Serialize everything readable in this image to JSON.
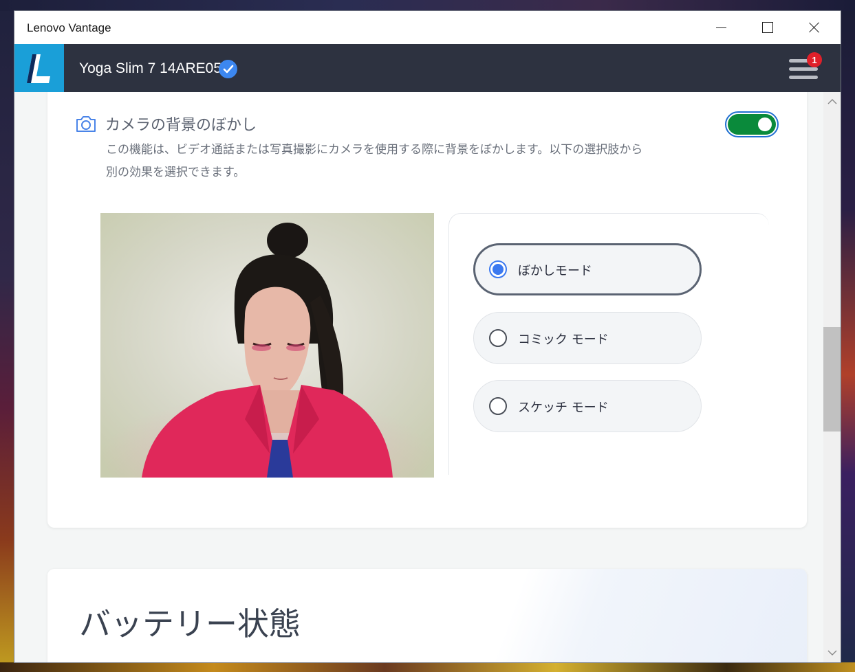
{
  "window": {
    "title": "Lenovo Vantage"
  },
  "header": {
    "device_name": "Yoga Slim 7 14ARE05",
    "menu_badge_count": "1"
  },
  "camera_blur": {
    "title": "カメラの背景のぼかし",
    "description": "この機能は、ビデオ通話または写真撮影にカメラを使用する際に背景をぼかします。以下の選択肢から別の効果を選択できます。",
    "enabled": true,
    "options": [
      {
        "label": "ぼかしモード",
        "selected": true
      },
      {
        "label": "コミック モード",
        "selected": false
      },
      {
        "label": "スケッチ モード",
        "selected": false
      }
    ]
  },
  "battery": {
    "title": "バッテリー状態"
  },
  "colors": {
    "toggle_on": "#0a8a3b",
    "accent_blue": "#3b79f0",
    "header_bg": "#2d3240",
    "logo_bg": "#1a9fd8",
    "badge": "#e0202a"
  },
  "icons": {
    "camera": "camera-icon",
    "verified": "check-circle-icon",
    "menu": "hamburger-menu-icon"
  }
}
